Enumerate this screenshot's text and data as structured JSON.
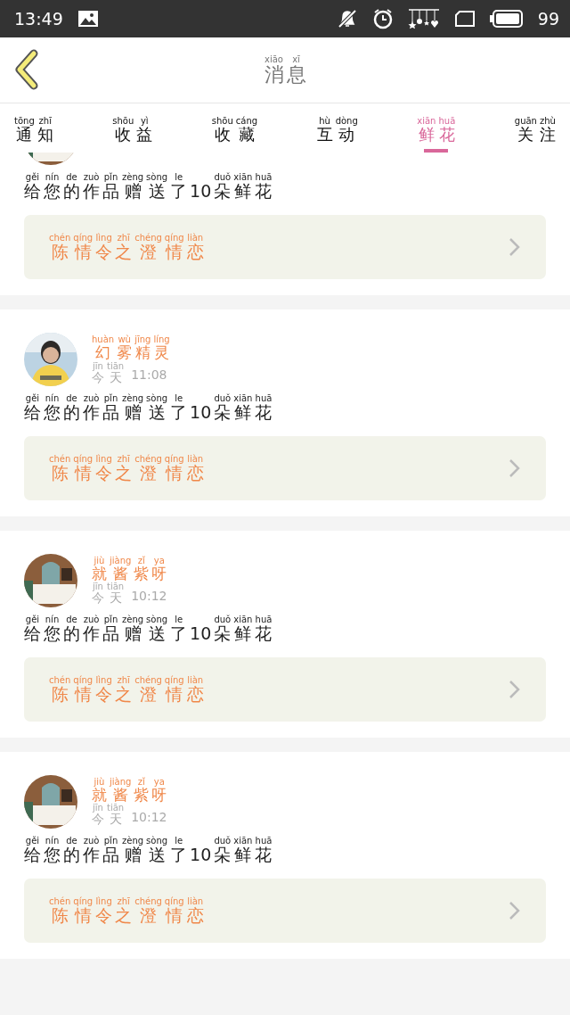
{
  "status_bar": {
    "time": "13:49",
    "battery": "99"
  },
  "header": {
    "title": [
      [
        "xiāo",
        "消"
      ],
      [
        "xī",
        "息"
      ]
    ]
  },
  "tabs": [
    {
      "label": [
        [
          "tōng",
          "通"
        ],
        [
          "zhī",
          "知"
        ]
      ],
      "selected": false
    },
    {
      "label": [
        [
          "shōu",
          "收"
        ],
        [
          "yì",
          "益"
        ]
      ],
      "selected": false
    },
    {
      "label": [
        [
          "shōu",
          "收"
        ],
        [
          "cáng",
          "藏"
        ]
      ],
      "selected": false
    },
    {
      "label": [
        [
          "hù",
          "互"
        ],
        [
          "dòng",
          "动"
        ]
      ],
      "selected": false
    },
    {
      "label": [
        [
          "xiān",
          "鲜"
        ],
        [
          "huā",
          "花"
        ]
      ],
      "selected": true
    },
    {
      "label": [
        [
          "guān",
          "关"
        ],
        [
          "zhù",
          "注"
        ]
      ],
      "selected": false
    }
  ],
  "messages": [
    {
      "kind": "clipped",
      "message": [
        [
          "gěi",
          "给"
        ],
        [
          "nín",
          "您"
        ],
        [
          "de",
          "的"
        ],
        [
          "zuò",
          "作"
        ],
        [
          "pǐn",
          "品"
        ],
        [
          "zèng",
          "赠"
        ],
        [
          "sòng",
          "送"
        ],
        [
          "le",
          "了"
        ],
        [
          "10"
        ],
        [
          "duǒ",
          "朵"
        ],
        [
          "xiān",
          "鲜"
        ],
        [
          "huā",
          "花"
        ]
      ],
      "work": [
        [
          "chén",
          "陈"
        ],
        [
          "qíng",
          "情"
        ],
        [
          "lìng",
          "令"
        ],
        [
          "zhī",
          "之"
        ],
        [
          "chéng",
          "澄"
        ],
        [
          "qíng",
          "情"
        ],
        [
          "liàn",
          "恋"
        ]
      ]
    },
    {
      "kind": "full",
      "avatar": {
        "kind": "picture"
      },
      "name": [
        [
          "huàn",
          "幻"
        ],
        [
          "wù",
          "雾"
        ],
        [
          "jīng",
          "精"
        ],
        [
          "líng",
          "灵"
        ]
      ],
      "date": [
        [
          "jīn",
          "今"
        ],
        [
          "tiān",
          "天"
        ]
      ],
      "time": "11:08",
      "message": [
        [
          "gěi",
          "给"
        ],
        [
          "nín",
          "您"
        ],
        [
          "de",
          "的"
        ],
        [
          "zuò",
          "作"
        ],
        [
          "pǐn",
          "品"
        ],
        [
          "zèng",
          "赠"
        ],
        [
          "sòng",
          "送"
        ],
        [
          "le",
          "了"
        ],
        [
          "10"
        ],
        [
          "duǒ",
          "朵"
        ],
        [
          "xiān",
          "鲜"
        ],
        [
          "huā",
          "花"
        ]
      ],
      "work": [
        [
          "chén",
          "陈"
        ],
        [
          "qíng",
          "情"
        ],
        [
          "lìng",
          "令"
        ],
        [
          "zhī",
          "之"
        ],
        [
          "chéng",
          "澄"
        ],
        [
          "qíng",
          "情"
        ],
        [
          "liàn",
          "恋"
        ]
      ]
    },
    {
      "kind": "full",
      "avatar": {
        "kind": "picture"
      },
      "name": [
        [
          "jiù",
          "就"
        ],
        [
          "jiàng",
          "酱"
        ],
        [
          "zǐ",
          "紫"
        ],
        [
          "ya",
          "呀"
        ]
      ],
      "date": [
        [
          "jīn",
          "今"
        ],
        [
          "tiān",
          "天"
        ]
      ],
      "time": "10:12",
      "message": [
        [
          "gěi",
          "给"
        ],
        [
          "nín",
          "您"
        ],
        [
          "de",
          "的"
        ],
        [
          "zuò",
          "作"
        ],
        [
          "pǐn",
          "品"
        ],
        [
          "zèng",
          "赠"
        ],
        [
          "sòng",
          "送"
        ],
        [
          "le",
          "了"
        ],
        [
          "10"
        ],
        [
          "duǒ",
          "朵"
        ],
        [
          "xiān",
          "鲜"
        ],
        [
          "huā",
          "花"
        ]
      ],
      "work": [
        [
          "chén",
          "陈"
        ],
        [
          "qíng",
          "情"
        ],
        [
          "lìng",
          "令"
        ],
        [
          "zhī",
          "之"
        ],
        [
          "chéng",
          "澄"
        ],
        [
          "qíng",
          "情"
        ],
        [
          "liàn",
          "恋"
        ]
      ]
    },
    {
      "kind": "full",
      "avatar": {
        "kind": "picture"
      },
      "name": [
        [
          "jiù",
          "就"
        ],
        [
          "jiàng",
          "酱"
        ],
        [
          "zǐ",
          "紫"
        ],
        [
          "ya",
          "呀"
        ]
      ],
      "date": [
        [
          "jīn",
          "今"
        ],
        [
          "tiān",
          "天"
        ]
      ],
      "time": "10:12",
      "message": [
        [
          "gěi",
          "给"
        ],
        [
          "nín",
          "您"
        ],
        [
          "de",
          "的"
        ],
        [
          "zuò",
          "作"
        ],
        [
          "pǐn",
          "品"
        ],
        [
          "zèng",
          "赠"
        ],
        [
          "sòng",
          "送"
        ],
        [
          "le",
          "了"
        ],
        [
          "10"
        ],
        [
          "duǒ",
          "朵"
        ],
        [
          "xiān",
          "鲜"
        ],
        [
          "huā",
          "花"
        ]
      ],
      "work": [
        [
          "chén",
          "陈"
        ],
        [
          "qíng",
          "情"
        ],
        [
          "lìng",
          "令"
        ],
        [
          "zhī",
          "之"
        ],
        [
          "chéng",
          "澄"
        ],
        [
          "qíng",
          "情"
        ],
        [
          "liàn",
          "恋"
        ]
      ]
    }
  ]
}
